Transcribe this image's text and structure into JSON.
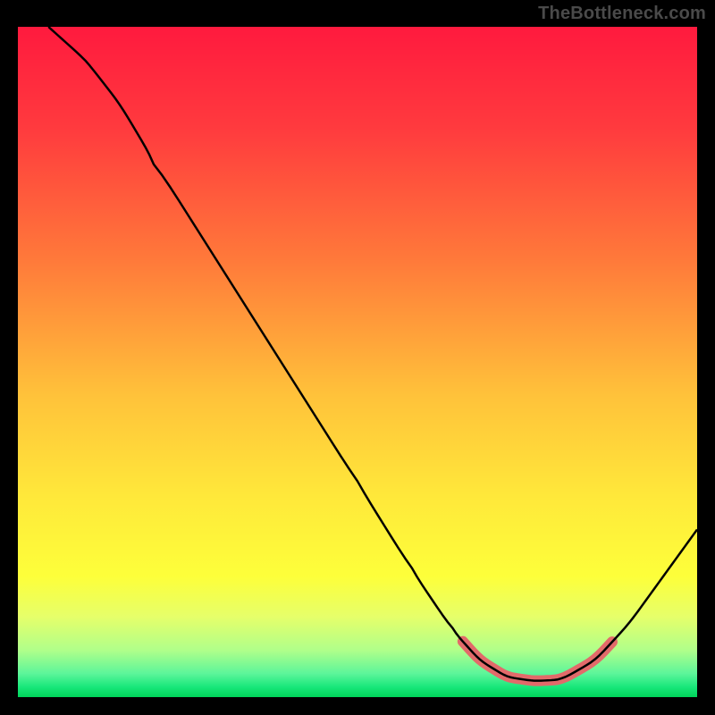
{
  "watermark": "TheBottleneck.com",
  "chart_data": {
    "type": "line",
    "title": "",
    "xlabel": "",
    "ylabel": "",
    "xlim": [
      0,
      100
    ],
    "ylim": [
      0,
      100
    ],
    "gradient_stops": [
      {
        "offset": 0.0,
        "color": "#ff1a3e"
      },
      {
        "offset": 0.15,
        "color": "#ff3a3e"
      },
      {
        "offset": 0.35,
        "color": "#ff7a3a"
      },
      {
        "offset": 0.55,
        "color": "#ffc23a"
      },
      {
        "offset": 0.7,
        "color": "#ffe83a"
      },
      {
        "offset": 0.82,
        "color": "#fdff3a"
      },
      {
        "offset": 0.88,
        "color": "#e6ff6a"
      },
      {
        "offset": 0.93,
        "color": "#b0ff8a"
      },
      {
        "offset": 0.965,
        "color": "#5cf59a"
      },
      {
        "offset": 0.985,
        "color": "#18e77a"
      },
      {
        "offset": 1.0,
        "color": "#00d45a"
      }
    ],
    "curve": [
      {
        "x": 4.5,
        "y": 100
      },
      {
        "x": 10,
        "y": 95
      },
      {
        "x": 15,
        "y": 88.5
      },
      {
        "x": 20,
        "y": 80
      },
      {
        "x": 30,
        "y": 64
      },
      {
        "x": 40,
        "y": 48
      },
      {
        "x": 50,
        "y": 32
      },
      {
        "x": 58,
        "y": 19
      },
      {
        "x": 64,
        "y": 10
      },
      {
        "x": 68,
        "y": 5.5
      },
      {
        "x": 72,
        "y": 3.0
      },
      {
        "x": 76,
        "y": 2.4
      },
      {
        "x": 80,
        "y": 2.6
      },
      {
        "x": 85,
        "y": 5.5
      },
      {
        "x": 90,
        "y": 11
      },
      {
        "x": 95,
        "y": 18
      },
      {
        "x": 100,
        "y": 25
      }
    ],
    "highlight_band": {
      "x_start": 65.5,
      "x_end": 88,
      "color": "#e26a6a",
      "stroke_width": 12
    }
  }
}
